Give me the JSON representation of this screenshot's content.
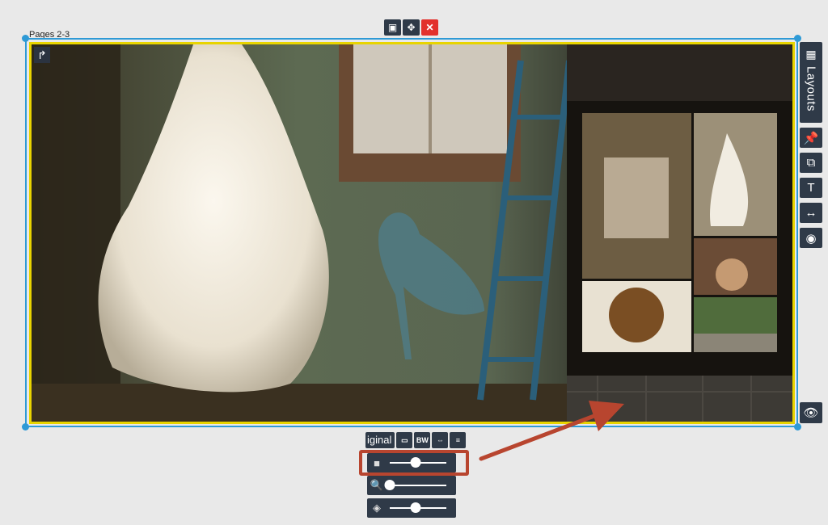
{
  "spread": {
    "page_label": "Pages 2-3"
  },
  "top_toolbar": {
    "close_glyph": "✕"
  },
  "side_toolbar": {
    "layouts_label": "Layouts",
    "icons": [
      "grid-icon",
      "pin-icon",
      "swap-icon",
      "text-icon",
      "fit-width-icon",
      "zoom-eye-icon"
    ]
  },
  "image_toolbar": {
    "original_label": "iginal",
    "bw_label": "BW"
  },
  "sliders": [
    {
      "name": "opacity",
      "icon": "layer-icon",
      "value": 0.45
    },
    {
      "name": "zoom",
      "icon": "magnifier-icon",
      "value": 0.0
    },
    {
      "name": "rotate",
      "icon": "rotate-icon",
      "value": 0.45
    }
  ],
  "colors": {
    "toolbar": "#2f3a48",
    "selection_blue": "#2e9ad6",
    "spread_border_yellow": "#e8d400",
    "close_red": "#e2312c",
    "annotation_arrow": "#b8452f"
  }
}
